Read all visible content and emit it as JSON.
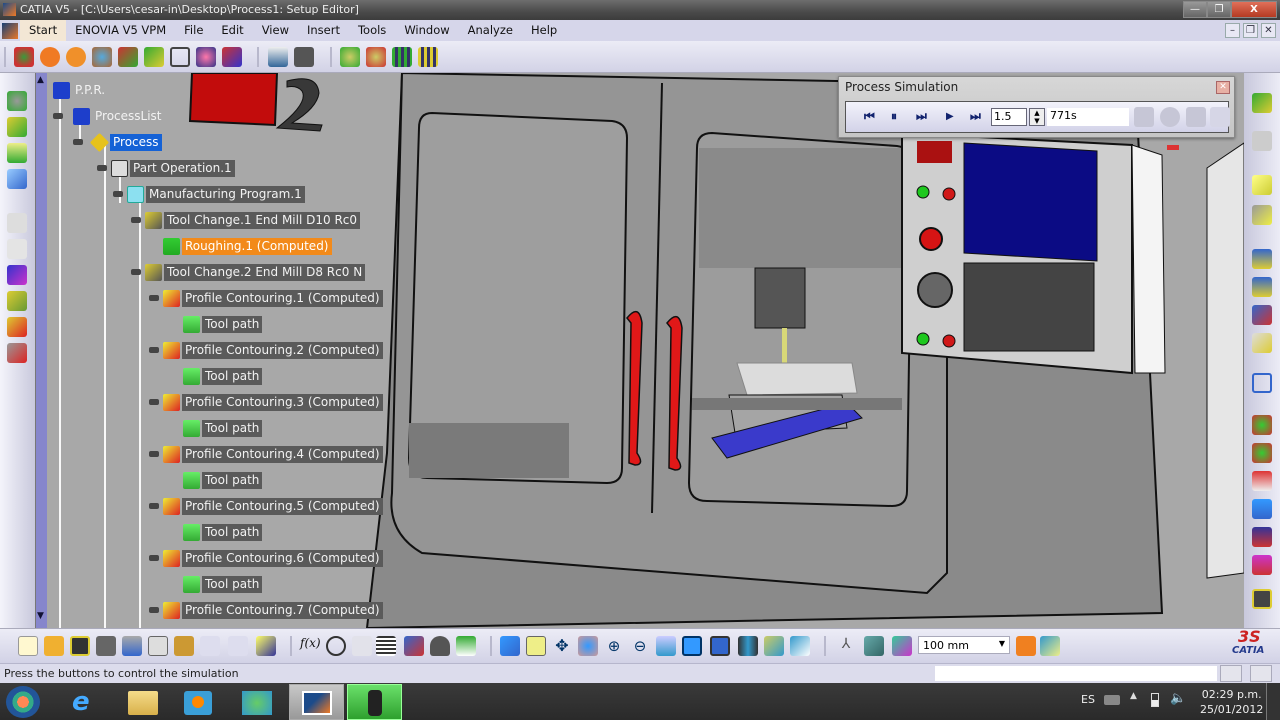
{
  "window": {
    "title": "CATIA V5 - [C:\\Users\\cesar-in\\Desktop\\Process1: Setup Editor]",
    "minimize": "—",
    "restore": "❐",
    "close": "X"
  },
  "menu": {
    "items": [
      "Start",
      "ENOVIA V5 VPM",
      "File",
      "Edit",
      "View",
      "Insert",
      "Tools",
      "Window",
      "Analyze",
      "Help"
    ],
    "doc_minimize": "–",
    "doc_restore": "❐",
    "doc_close": "✕"
  },
  "tree": {
    "root": "P.P.R.",
    "process_list": "ProcessList",
    "process": "Process",
    "part_operation": "Part Operation.1",
    "program": "Manufacturing Program.1",
    "tool_change_1": "Tool Change.1  End Mill D10 Rc0",
    "roughing": "Roughing.1 (Computed)",
    "tool_change_2": "Tool Change.2  End Mill D8 Rc0 N",
    "operations": [
      {
        "label": "Profile Contouring.1 (Computed)",
        "child": "Tool path"
      },
      {
        "label": "Profile Contouring.2 (Computed)",
        "child": "Tool path"
      },
      {
        "label": "Profile Contouring.3 (Computed)",
        "child": "Tool path"
      },
      {
        "label": "Profile Contouring.4 (Computed)",
        "child": "Tool path"
      },
      {
        "label": "Profile Contouring.5 (Computed)",
        "child": "Tool path"
      },
      {
        "label": "Profile Contouring.6 (Computed)",
        "child": "Tool path"
      },
      {
        "label": "Profile Contouring.7 (Computed)",
        "child": null
      }
    ]
  },
  "process_simulation": {
    "title": "Process Simulation",
    "buttons": {
      "rewind": "⏮",
      "pause": "⏸",
      "step": "⏭",
      "play": "▶",
      "fast_forward": "⏭"
    },
    "speed_value": "1.5",
    "time_value": "771s"
  },
  "bottom_toolbar": {
    "zoom_value": "100 mm"
  },
  "status": {
    "message": "Press the buttons to control the simulation"
  },
  "taskbar": {
    "language": "ES",
    "time": "02:29 p.m.",
    "date": "25/01/2012"
  },
  "branding": {
    "logo_text": "CATIA"
  },
  "colors": {
    "selection": "#1562d6",
    "highlight": "#f28a1a",
    "tree_label_bg": "#5a5a5a",
    "scrollbar": "#8686cc"
  }
}
